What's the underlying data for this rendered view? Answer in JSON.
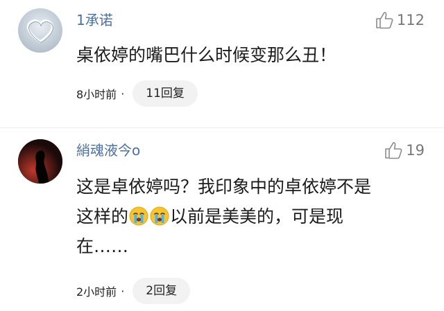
{
  "comments": [
    {
      "avatar_icon": "heart-avatar-icon",
      "username": "1承诺",
      "likes": "112",
      "text": "桌依婷的嘴巴什么时候变那么丑！",
      "time": "8小时前",
      "separator": "·",
      "replies": "11回复"
    },
    {
      "avatar_icon": "silhouette-avatar-icon",
      "username": "綃魂液今o",
      "likes": "19",
      "text_line1": "这是卓依婷吗？我印象中的卓依婷不是",
      "text_line2_a": "这样的",
      "emoji_name": "crying-face-icon",
      "text_line2_b": "以前是美美的，可是现",
      "text_line3": "在……",
      "time": "2小时前",
      "separator": "·",
      "replies": "2回复"
    }
  ],
  "colors": {
    "username": "#4a6fa5",
    "meta_text": "#222222",
    "like_icon": "#8a8a8a",
    "reply_bg": "#f2f2f2"
  }
}
